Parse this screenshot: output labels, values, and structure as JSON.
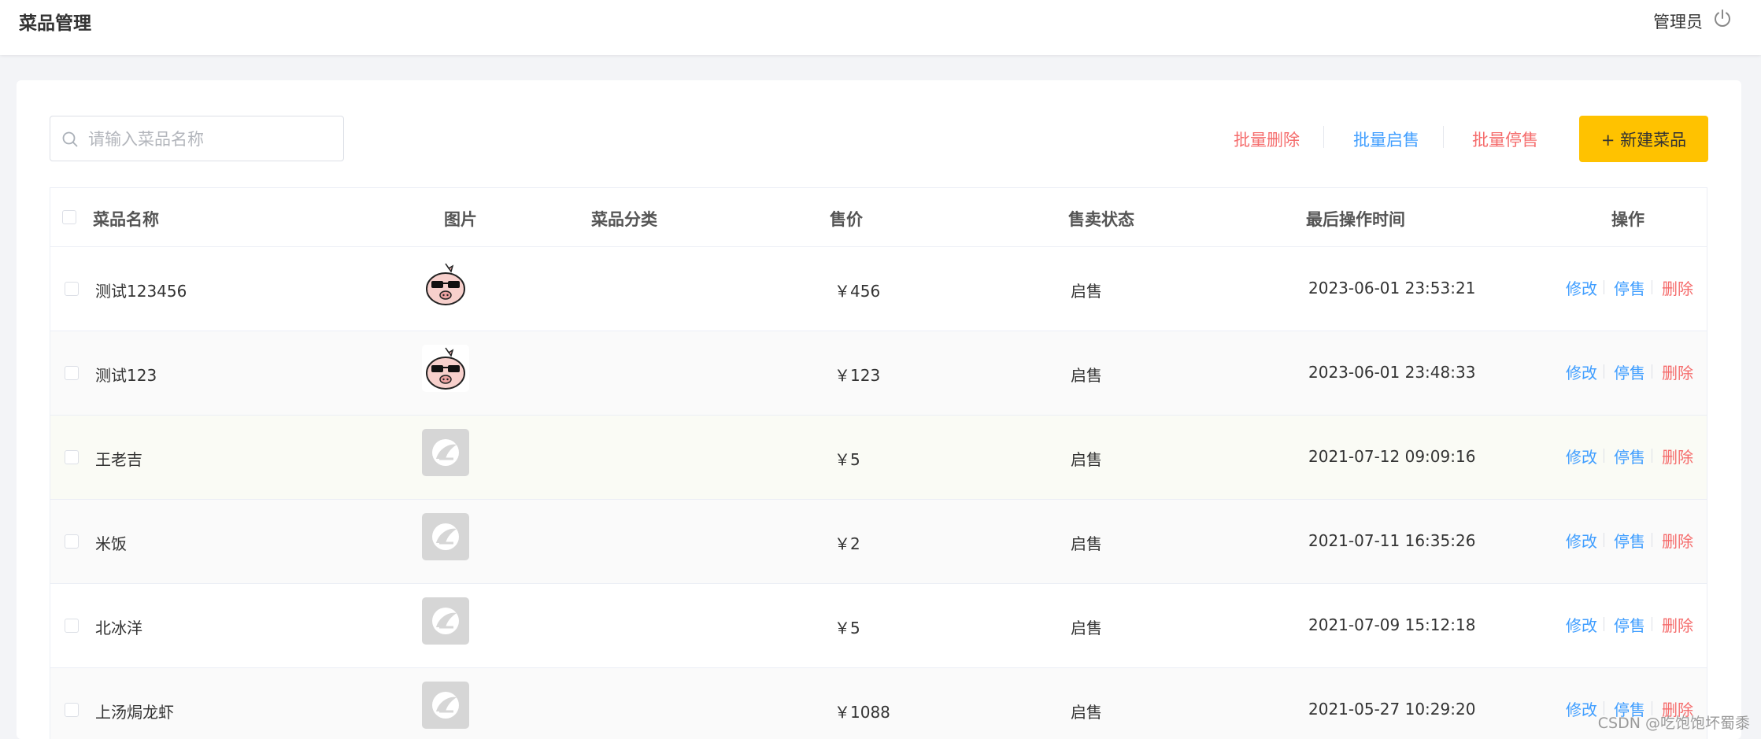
{
  "header": {
    "title": "菜品管理",
    "user": "管理员"
  },
  "toolbar": {
    "search_placeholder": "请输入菜品名称",
    "bulk_delete": "批量删除",
    "bulk_enable": "批量启售",
    "bulk_disable": "批量停售",
    "new_button": "+ 新建菜品"
  },
  "table": {
    "headers": [
      "菜品名称",
      "图片",
      "菜品分类",
      "售价",
      "售卖状态",
      "最后操作时间",
      "操作"
    ],
    "rows": [
      {
        "name": "测试123456",
        "image": "pig-sunglasses",
        "category": "",
        "price": "￥456",
        "status": "启售",
        "updated": "2023-06-01 23:53:21"
      },
      {
        "name": "测试123",
        "image": "pig-sunglasses",
        "category": "",
        "price": "￥123",
        "status": "启售",
        "updated": "2023-06-01 23:48:33"
      },
      {
        "name": "王老吉",
        "image": "placeholder-logo",
        "category": "",
        "price": "￥5",
        "status": "启售",
        "updated": "2021-07-12 09:09:16"
      },
      {
        "name": "米饭",
        "image": "placeholder-logo",
        "category": "",
        "price": "￥2",
        "status": "启售",
        "updated": "2021-07-11 16:35:26"
      },
      {
        "name": "北冰洋",
        "image": "placeholder-logo",
        "category": "",
        "price": "￥5",
        "status": "启售",
        "updated": "2021-07-09 15:12:18"
      },
      {
        "name": "上汤焗龙虾",
        "image": "placeholder-logo",
        "category": "",
        "price": "￥1088",
        "status": "启售",
        "updated": "2021-05-27 10:29:20"
      }
    ],
    "actions": {
      "edit": "修改",
      "disable": "停售",
      "delete": "删除"
    }
  },
  "watermark": "CSDN @吃饱饱坏蜀黍",
  "colors": {
    "accent": "#ffc200",
    "link_blue": "#409eff",
    "danger_red": "#f56c6c"
  }
}
